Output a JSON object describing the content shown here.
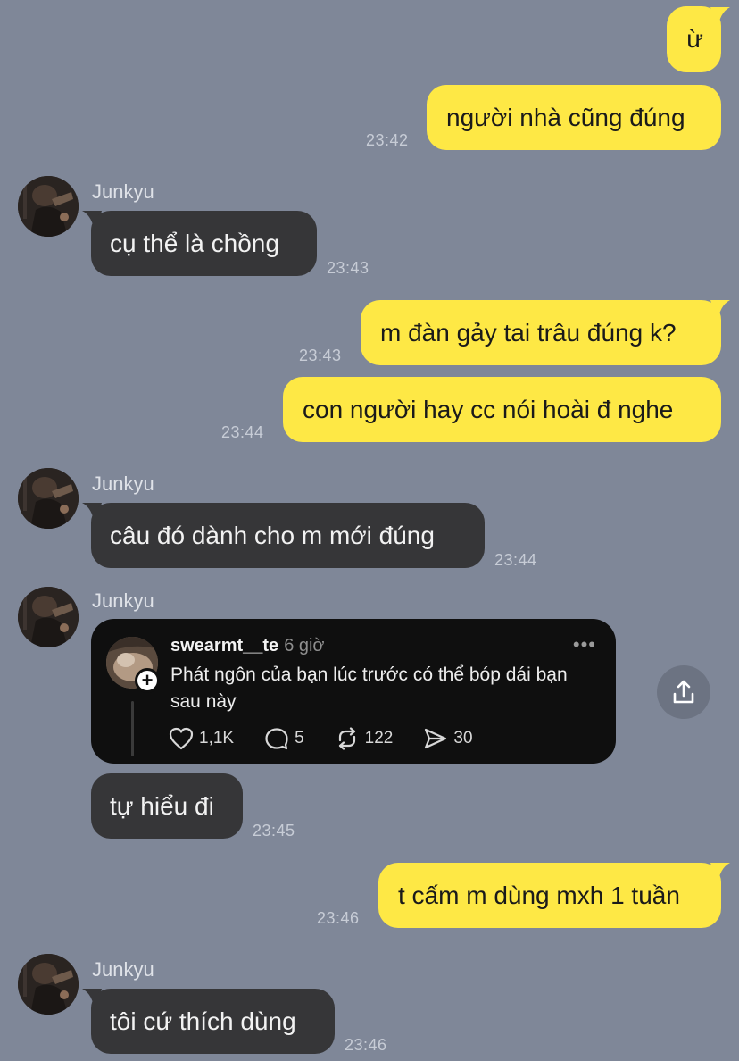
{
  "contact": {
    "name": "Junkyu"
  },
  "messages": [
    {
      "text": "ừ"
    },
    {
      "text": "người nhà cũng đúng",
      "time": "23:42"
    },
    {
      "text": "cụ thể là chồng",
      "time": "23:43"
    },
    {
      "text": "m đàn gảy tai trâu đúng k?",
      "time": "23:43"
    },
    {
      "text": "con người hay cc nói hoài đ nghe",
      "time": "23:44"
    },
    {
      "text": "câu đó dành cho m mới đúng",
      "time": "23:44"
    },
    {
      "text": "tự hiểu đi",
      "time": "23:45"
    },
    {
      "text": "t cấm m dùng mxh 1 tuần",
      "time": "23:46"
    },
    {
      "text": "tôi cứ thích dùng",
      "time": "23:46"
    }
  ],
  "thread_card": {
    "username": "swearmt__te",
    "age": "6 giờ",
    "more": "•••",
    "plus": "+",
    "text": "Phát ngôn của bạn lúc trước có thể bóp dái bạn sau này",
    "likes": "1,1K",
    "comments": "5",
    "reposts": "122",
    "shares": "30"
  },
  "icons": {
    "avatar": "avatar-photo",
    "share": "share-icon",
    "like": "heart-icon",
    "comment": "comment-icon",
    "repost": "repost-icon",
    "send": "send-icon"
  },
  "colors": {
    "background": "#7f8798",
    "outgoing_bubble": "#fee845",
    "incoming_bubble": "#363638",
    "card": "#0f0f0f"
  }
}
